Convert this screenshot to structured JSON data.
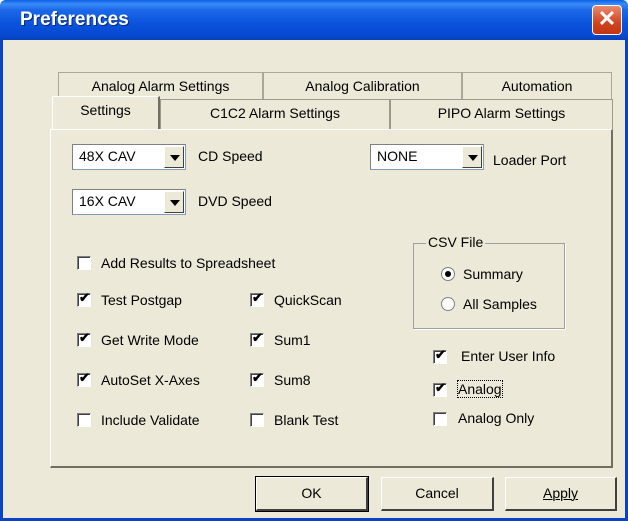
{
  "window": {
    "title": "Preferences"
  },
  "tabs": {
    "back": [
      "Analog Alarm Settings",
      "Analog Calibration",
      "Automation"
    ],
    "front": [
      "Settings",
      "C1C2 Alarm Settings",
      "PIPO Alarm Settings"
    ]
  },
  "settings": {
    "cd_speed": {
      "value": "48X CAV",
      "label": "CD Speed"
    },
    "dvd_speed": {
      "value": "16X CAV",
      "label": "DVD Speed"
    },
    "loader_port": {
      "value": "NONE",
      "label": "Loader Port"
    },
    "checkboxes": {
      "add_results": {
        "label": "Add Results to Spreadsheet",
        "checked": false
      },
      "test_postgap": {
        "label": "Test Postgap",
        "checked": true
      },
      "get_write_mode": {
        "label": "Get Write Mode",
        "checked": true
      },
      "autoset_x_axes": {
        "label": "AutoSet X-Axes",
        "checked": true
      },
      "include_validate": {
        "label": "Include Validate",
        "checked": false
      },
      "quickscan": {
        "label": "QuickScan",
        "checked": true
      },
      "sum1": {
        "label": "Sum1",
        "checked": true
      },
      "sum8": {
        "label": "Sum8",
        "checked": true
      },
      "blank_test": {
        "label": "Blank Test",
        "checked": false
      },
      "enter_user_info": {
        "label": "Enter User Info",
        "checked": true
      },
      "analog": {
        "label": "Analog",
        "checked": true
      },
      "analog_only": {
        "label": "Analog Only",
        "checked": false
      }
    },
    "csv_file": {
      "title": "CSV File",
      "options": [
        {
          "label": "Summary",
          "selected": true
        },
        {
          "label": "All Samples",
          "selected": false
        }
      ]
    }
  },
  "buttons": {
    "ok": "OK",
    "cancel": "Cancel",
    "apply": "Apply"
  }
}
